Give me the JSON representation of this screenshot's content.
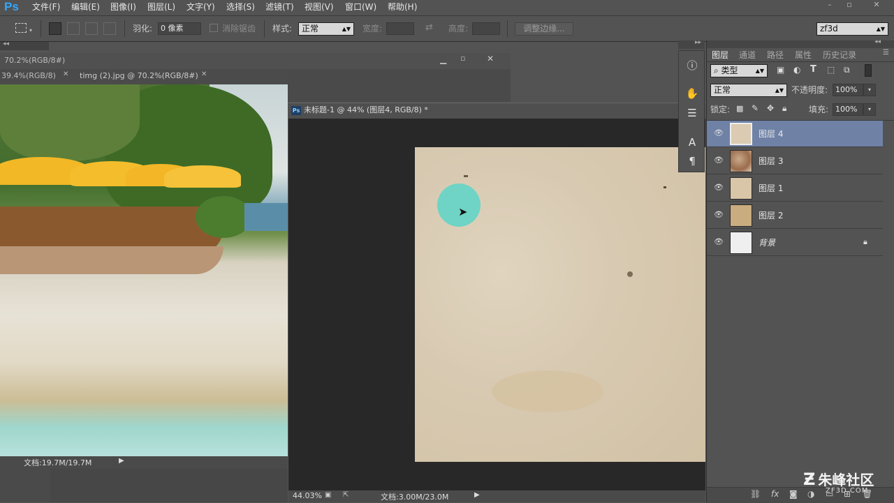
{
  "menubar": {
    "logo": "Ps",
    "items": [
      "文件(F)",
      "编辑(E)",
      "图像(I)",
      "图层(L)",
      "文字(Y)",
      "选择(S)",
      "滤镜(T)",
      "视图(V)",
      "窗口(W)",
      "帮助(H)"
    ],
    "window_controls": [
      "–",
      "▫",
      "✕"
    ]
  },
  "options": {
    "feather_label": "羽化:",
    "feather_value": "0 像素",
    "antialias_label": "消除锯齿",
    "style_label": "样式:",
    "style_value": "正常",
    "width_label": "宽度:",
    "height_label": "高度:",
    "refine_edge": "调整边缘...",
    "workspace": "zf3d"
  },
  "doc1": {
    "tab_title_partial": "70.2%(RGB/8#)",
    "tab_a": "39.4%(RGB/8)",
    "tab_b": "timg (2).jpg @ 70.2%(RGB/8#)",
    "status": "文档:19.7M/19.7M"
  },
  "doc2": {
    "title": "未标题-1 @ 44% (图层4, RGB/8) *",
    "zoom": "44.03%",
    "status": "文档:3.00M/23.0M"
  },
  "layers_panel": {
    "tabs": [
      "图层",
      "通道",
      "路径",
      "属性",
      "历史记录"
    ],
    "filter_kind": "类型",
    "blend_mode": "正常",
    "opacity_label": "不透明度:",
    "opacity_value": "100%",
    "lock_label": "锁定:",
    "fill_label": "填充:",
    "fill_value": "100%",
    "layers": [
      {
        "name": "图层 4",
        "selected": true
      },
      {
        "name": "图层 3",
        "selected": false
      },
      {
        "name": "图层 1",
        "selected": false
      },
      {
        "name": "图层 2",
        "selected": false
      },
      {
        "name": "背景",
        "selected": false
      }
    ],
    "footer_icons": [
      "link-icon",
      "fx-icon",
      "mask-icon",
      "adjustment-icon",
      "group-icon",
      "new-layer-icon",
      "trash-icon"
    ]
  },
  "watermark": {
    "text": "朱峰社区",
    "sub": "ZF3D.COM"
  },
  "colors": {
    "accent": "#31a8ff",
    "selected_layer": "#6f82a6",
    "brush_circle": "#6fd4c5"
  }
}
